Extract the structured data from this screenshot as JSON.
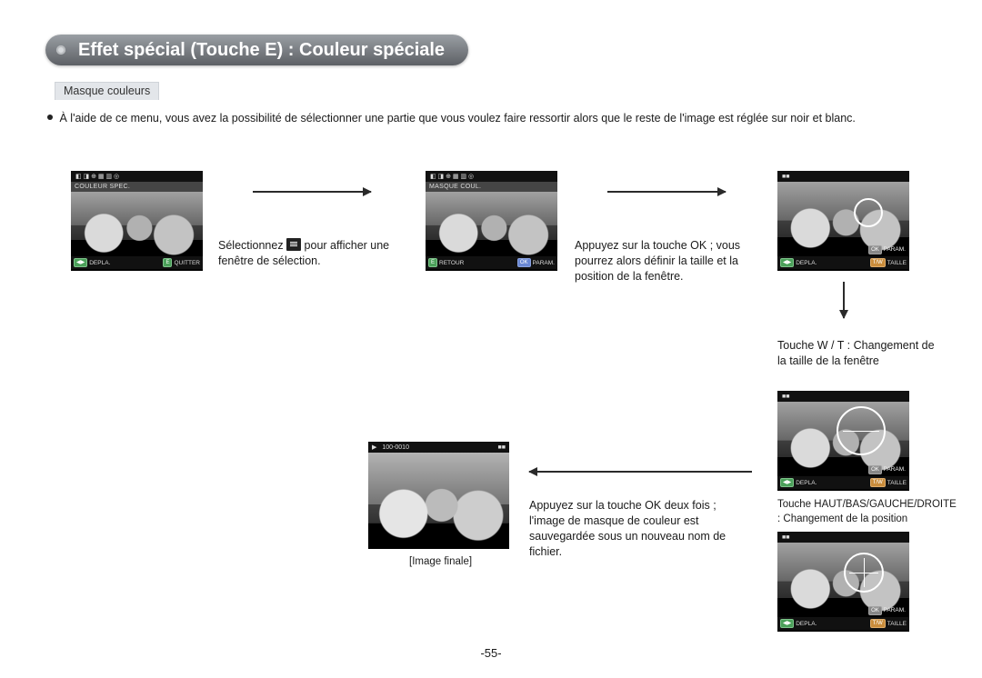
{
  "title": "Effet spécial (Touche E) : Couleur spéciale",
  "subsection": "Masque couleurs",
  "intro": "À l'aide de ce menu, vous avez la possibilité de sélectionner une partie que vous voulez faire ressortir alors que le reste de l'image est réglée sur noir et blanc.",
  "step1": {
    "lcd_label": "COULEUR SPEC.",
    "key_left1": "◀▶",
    "key_left1_label": "DEPLA.",
    "key_right1": "E",
    "key_right1_label": "QUITTER",
    "caption_prefix": "Sélectionnez ",
    "caption_suffix": " pour afficher une fenêtre de sélection."
  },
  "step2": {
    "lcd_label": "MASQUE COUL.",
    "key_left1": "E",
    "key_left1_label": "RETOUR",
    "key_right1": "OK",
    "key_right1_label": "PARAM.",
    "caption": "Appuyez sur la touche OK ; vous pourrez alors définir la taille et la position de la fenêtre."
  },
  "step3": {
    "key_left1": "◀▶",
    "key_left1_label": "DEPLA.",
    "key_right1": "T/W",
    "key_right1_label": "TAILLE",
    "key_ok": "OK",
    "key_ok_label": "PARAM.",
    "caption": "Touche W / T : Changement de la taille de la fenêtre"
  },
  "step3b": {
    "key_left1": "◀▶",
    "key_left1_label": "DEPLA.",
    "key_right1": "T/W",
    "key_right1_label": "TAILLE",
    "key_ok": "OK",
    "key_ok_label": "PARAM."
  },
  "step4": {
    "key_left1": "◀▶",
    "key_left1_label": "DEPLA.",
    "key_right1": "T/W",
    "key_right1_label": "TAILLE",
    "key_ok": "OK",
    "key_ok_label": "PARAM.",
    "caption": "Touche HAUT/BAS/GAUCHE/DROITE : Changement de la position"
  },
  "final": {
    "file_id": "100-0010",
    "label": "[Image finale]",
    "caption": "Appuyez sur la touche OK deux fois ; l'image de masque de couleur est sauvegardée sous un nouveau nom de fichier."
  },
  "page_number": "-55-"
}
